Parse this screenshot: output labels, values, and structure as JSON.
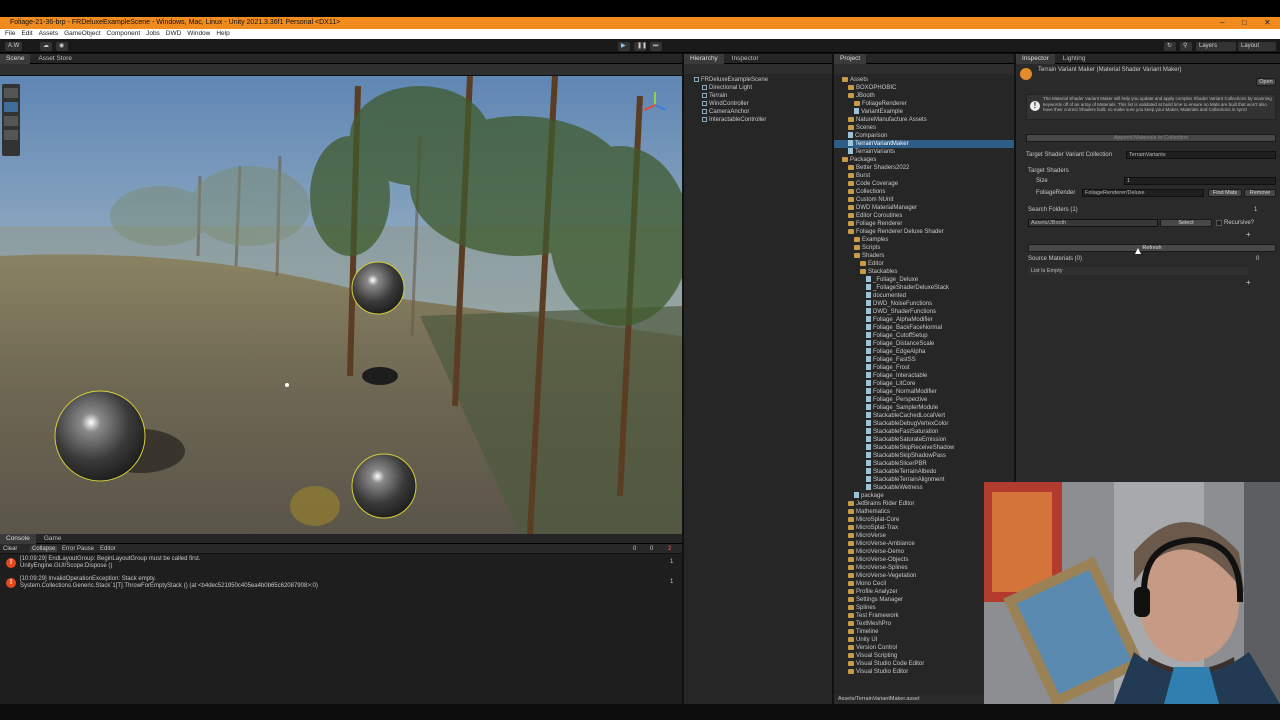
{
  "window": {
    "title": "Foliage-21-36-brp - FRDeluxeExampleScene - Windows, Mac, Linux - Unity 2021.3.36f1 Personal <DX11>"
  },
  "menu": [
    "File",
    "Edit",
    "Assets",
    "GameObject",
    "Component",
    "Jobs",
    "DWD",
    "Window",
    "Help"
  ],
  "toolbar": {
    "account": "A.W",
    "layers": "Layers",
    "layout": "Layout"
  },
  "scene_tabs": [
    "Scene",
    "Asset Store"
  ],
  "hierarchy": {
    "tabs": [
      "Hierarchy",
      "Inspector"
    ],
    "items": [
      {
        "label": "FRDeluxeExampleScene",
        "depth": 0
      },
      {
        "label": "Directional Light",
        "depth": 1
      },
      {
        "label": "Terrain",
        "depth": 1
      },
      {
        "label": "WindController",
        "depth": 1
      },
      {
        "label": "CameraAnchor",
        "depth": 1
      },
      {
        "label": "InteractableController",
        "depth": 1
      }
    ]
  },
  "project": {
    "tab": "Project",
    "items": [
      {
        "label": "Assets",
        "depth": 0,
        "kind": "folder"
      },
      {
        "label": "BOXOPHOBIC",
        "depth": 1,
        "kind": "folder"
      },
      {
        "label": "JBooth",
        "depth": 1,
        "kind": "folder"
      },
      {
        "label": "FoliageRenderer",
        "depth": 2,
        "kind": "folder"
      },
      {
        "label": "VariantExample",
        "depth": 2,
        "kind": "file"
      },
      {
        "label": "NatureManufacture Assets",
        "depth": 1,
        "kind": "folder"
      },
      {
        "label": "Scenes",
        "depth": 1,
        "kind": "folder"
      },
      {
        "label": "Comparison",
        "depth": 1,
        "kind": "file"
      },
      {
        "label": "TerrainVariantMaker",
        "depth": 1,
        "kind": "file",
        "selected": true
      },
      {
        "label": "TerrainVariants",
        "depth": 1,
        "kind": "file"
      },
      {
        "label": "Packages",
        "depth": 0,
        "kind": "folder"
      },
      {
        "label": "Better Shaders2022",
        "depth": 1,
        "kind": "folder"
      },
      {
        "label": "Burst",
        "depth": 1,
        "kind": "folder"
      },
      {
        "label": "Code Coverage",
        "depth": 1,
        "kind": "folder"
      },
      {
        "label": "Collections",
        "depth": 1,
        "kind": "folder"
      },
      {
        "label": "Custom NUnit",
        "depth": 1,
        "kind": "folder"
      },
      {
        "label": "DWD MaterialManager",
        "depth": 1,
        "kind": "folder"
      },
      {
        "label": "Editor Coroutines",
        "depth": 1,
        "kind": "folder"
      },
      {
        "label": "Foliage Renderer",
        "depth": 1,
        "kind": "folder"
      },
      {
        "label": "Foliage Renderer Deluxe Shader",
        "depth": 1,
        "kind": "folder"
      },
      {
        "label": "Examples",
        "depth": 2,
        "kind": "folder"
      },
      {
        "label": "Scripts",
        "depth": 2,
        "kind": "folder"
      },
      {
        "label": "Shaders",
        "depth": 2,
        "kind": "folder"
      },
      {
        "label": "Editor",
        "depth": 3,
        "kind": "folder"
      },
      {
        "label": "Stackables",
        "depth": 3,
        "kind": "folder"
      },
      {
        "label": "_Foliage_Deluxe",
        "depth": 4,
        "kind": "file"
      },
      {
        "label": "_FoliageShaderDeluxeStack",
        "depth": 4,
        "kind": "file"
      },
      {
        "label": "documented",
        "depth": 4,
        "kind": "file"
      },
      {
        "label": "DWD_NoiseFunctions",
        "depth": 4,
        "kind": "file"
      },
      {
        "label": "DWD_ShaderFunctions",
        "depth": 4,
        "kind": "file"
      },
      {
        "label": "Foliage_AlphaModifier",
        "depth": 4,
        "kind": "file"
      },
      {
        "label": "Foliage_BackFaceNormal",
        "depth": 4,
        "kind": "file"
      },
      {
        "label": "Foliage_CutoffSetup",
        "depth": 4,
        "kind": "file"
      },
      {
        "label": "Foliage_DistanceScale",
        "depth": 4,
        "kind": "file"
      },
      {
        "label": "Foliage_EdgeAlpha",
        "depth": 4,
        "kind": "file"
      },
      {
        "label": "Foliage_FastSS",
        "depth": 4,
        "kind": "file"
      },
      {
        "label": "Foliage_Frost",
        "depth": 4,
        "kind": "file"
      },
      {
        "label": "Foliage_Interactable",
        "depth": 4,
        "kind": "file"
      },
      {
        "label": "Foliage_LitCore",
        "depth": 4,
        "kind": "file"
      },
      {
        "label": "Foliage_NormalModifier",
        "depth": 4,
        "kind": "file"
      },
      {
        "label": "Foliage_Perspective",
        "depth": 4,
        "kind": "file"
      },
      {
        "label": "Foliage_SamplerModule",
        "depth": 4,
        "kind": "file"
      },
      {
        "label": "StackableCachedLocalVert",
        "depth": 4,
        "kind": "file"
      },
      {
        "label": "StackableDebugVertexColor",
        "depth": 4,
        "kind": "file"
      },
      {
        "label": "StackableFastSaturation",
        "depth": 4,
        "kind": "file"
      },
      {
        "label": "StackableSaturateEmission",
        "depth": 4,
        "kind": "file"
      },
      {
        "label": "StackableSkipReceiveShadow",
        "depth": 4,
        "kind": "file"
      },
      {
        "label": "StackableSkipShadowPass",
        "depth": 4,
        "kind": "file"
      },
      {
        "label": "StackableSlicerPBR",
        "depth": 4,
        "kind": "file"
      },
      {
        "label": "StackableTerrainAlbedo",
        "depth": 4,
        "kind": "file"
      },
      {
        "label": "StackableTerrainAlignment",
        "depth": 4,
        "kind": "file"
      },
      {
        "label": "StackableWetness",
        "depth": 4,
        "kind": "file"
      },
      {
        "label": "package",
        "depth": 2,
        "kind": "file"
      },
      {
        "label": "JetBrains Rider Editor",
        "depth": 1,
        "kind": "folder"
      },
      {
        "label": "Mathematics",
        "depth": 1,
        "kind": "folder"
      },
      {
        "label": "MicroSplat-Core",
        "depth": 1,
        "kind": "folder"
      },
      {
        "label": "MicroSplat-Trax",
        "depth": 1,
        "kind": "folder"
      },
      {
        "label": "MicroVerse",
        "depth": 1,
        "kind": "folder"
      },
      {
        "label": "MicroVerse-Ambiance",
        "depth": 1,
        "kind": "folder"
      },
      {
        "label": "MicroVerse-Demo",
        "depth": 1,
        "kind": "folder"
      },
      {
        "label": "MicroVerse-Objects",
        "depth": 1,
        "kind": "folder"
      },
      {
        "label": "MicroVerse-Splines",
        "depth": 1,
        "kind": "folder"
      },
      {
        "label": "MicroVerse-Vegetation",
        "depth": 1,
        "kind": "folder"
      },
      {
        "label": "Mono Cecil",
        "depth": 1,
        "kind": "folder"
      },
      {
        "label": "Profile Analyzer",
        "depth": 1,
        "kind": "folder"
      },
      {
        "label": "Settings Manager",
        "depth": 1,
        "kind": "folder"
      },
      {
        "label": "Splines",
        "depth": 1,
        "kind": "folder"
      },
      {
        "label": "Test Framework",
        "depth": 1,
        "kind": "folder"
      },
      {
        "label": "TextMeshPro",
        "depth": 1,
        "kind": "folder"
      },
      {
        "label": "Timeline",
        "depth": 1,
        "kind": "folder"
      },
      {
        "label": "Unity UI",
        "depth": 1,
        "kind": "folder"
      },
      {
        "label": "Version Control",
        "depth": 1,
        "kind": "folder"
      },
      {
        "label": "Visual Scripting",
        "depth": 1,
        "kind": "folder"
      },
      {
        "label": "Visual Studio Code Editor",
        "depth": 1,
        "kind": "folder"
      },
      {
        "label": "Visual Studio Editor",
        "depth": 1,
        "kind": "folder"
      }
    ],
    "footer_path": "Assets/TerrainVariantMaker.asset"
  },
  "inspector": {
    "tabs": [
      "Inspector",
      "Lighting"
    ],
    "title": "Terrain Variant Maker (Material Shader Variant Maker)",
    "open_button": "Open",
    "info": "The Material Shader Variant Maker will help you update and apply complex Shader Variant Collections by scanning keywords off of an array of Materials. This list is validated at build time to ensure no Mats are built that won't also have their correct Shaders built, so make sure you keep your Maker, Materials and Collections in sync!",
    "append_button": "Append Materials to Collection",
    "target_collection_label": "Target Shader Variant Collection",
    "target_collection_value": "TerrainVariants",
    "target_shaders_label": "Target Shaders",
    "size_label": "Size",
    "size_value": "1",
    "shader_row_label": "FoliageRender",
    "shader_row_value": "FoliageRenderer/Deluxe",
    "find_mats": "Find Mats",
    "remove": "Remove",
    "search_folders_label": "Search Folders (1)",
    "search_folders_count": "1",
    "folder_value": "Assets/JBooth",
    "select_button": "Select",
    "recursive_label": "Recursive?",
    "refresh_button": "Refresh",
    "source_materials_label": "Source Materials (0)",
    "source_materials_count": "0",
    "list_empty": "List Is Empty"
  },
  "console": {
    "tabs": [
      "Console",
      "Game"
    ],
    "buttons": [
      "Clear",
      "Collapse",
      "Error Pause",
      "Editor"
    ],
    "counts": [
      "0",
      "0",
      "2"
    ],
    "messages": [
      {
        "line1": "[10:09:29] EndLayoutGroup: BeginLayoutGroup must be called first.",
        "line2": "UnityEngine.GUI/Scope:Dispose ()",
        "count": "1"
      },
      {
        "line1": "[10:09:29] InvalidOperationException: Stack empty.",
        "line2": "System.Collections.Generic.Stack`1[T].ThrowForEmptyStack () (at <b4dec521950c405ea4b0b65c62087908>:0)",
        "count": "1"
      }
    ]
  }
}
